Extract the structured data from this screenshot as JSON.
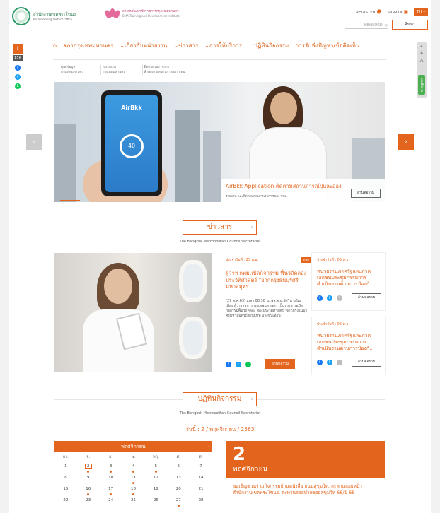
{
  "header": {
    "logo1_title": "สำนักงานเขตพระโขนง",
    "logo1_sub": "Phrakhanong District Office",
    "logo2_title": "สถาบันพัฒนาข้าราชการกรุงเทพมหานคร",
    "logo2_sub": "BMA Training and Development Institute",
    "register": "REGISTER",
    "signin": "SIGN IN",
    "lang": "TH",
    "keyword_placeholder": "KEYWORD",
    "search_btn": "ค้นหา"
  },
  "social": {
    "share_count": "15K"
  },
  "right_tools": {
    "a1": "A",
    "a2": "A",
    "a3": "A",
    "label": "กลุ่มนี้มีตาม"
  },
  "nav": {
    "items": [
      "สภากรุงเทพมหานคร",
      "เกี่ยวกับหน่วยงาน",
      "ข่าวสาร",
      "การให้บริการ",
      "ปฏิทินกิจกรรม",
      "การรับฟังปัญหา/ข้อคิดเห็น"
    ],
    "sub": [
      {
        "l1": "ศูนย์ข้อมูล",
        "l2": "กรุงเทพมหานคร"
      },
      {
        "l1": "หน่วยงาน",
        "l2": "กรุงเทพมหานคร"
      },
      {
        "l1": "ติดต่อส่วนราชการ",
        "l2": "สำนักงานเลขานุการสภา กทม."
      }
    ]
  },
  "hero": {
    "app_name": "AirBkk",
    "ring_value": "40",
    "caption_title": "AirBkk Application ติดตามสถานการณ์ฝุ่นละออง",
    "caption_sub": "รายงาน และติดตามคุณภาพอากาศของ กทม.",
    "button": "อ่านต่อรวม"
  },
  "news": {
    "header": "ข่าวสาร",
    "subtitle": "The Bangkok Metropolitan Council Secretariat",
    "featured": {
      "date": "ประจำวันที่ : 25 พ.ย.",
      "badge": "ล่าสุด",
      "title": "ผู้ว่าฯ กทม.เปิดกิจกรรม ฟื้นวิถีคลอง ประวัติศาสตร์ \"จากกรุงธนบุรีศรีมหาสมุทร..",
      "body": "(27 ต.ค.63) เวลา 08.30 น. พล.ต.อ.อัศวิน ขวัญเมือง ผู้ว่าราชการกรุงเทพมหานคร เป็นประธานเปิดกิจกรรมฟื้นวิถีคลอง ส่องประวัติศาสตร์ \"จากกรุงธนบุรีศรีมหาสมุทรถึงกรุงเทพ บางขุนเทียน\"",
      "button": "อ่านต่อรวม"
    },
    "cards": [
      {
        "date": "ประจำวันที่ : 05 พ.ย.",
        "title": "หน่วยงานภาครัฐและภาคเอกชนประชุมกรรมการดำเนินงานด้านการป้องกั..",
        "button": "อ่านต่อรวม"
      },
      {
        "date": "ประจำวันที่ : 05 พ.ย.",
        "title": "หน่วยงานภาครัฐและภาคเอกชนประชุมกรรมการดำเนินงานด้านการป้องกั..",
        "button": "อ่านต่อรวม"
      }
    ]
  },
  "activities": {
    "header": "ปฏิทินกิจกรรม",
    "subtitle": "The Bangkok Metropolitan Council Secretariat",
    "date_line": "วันนี้ : 2 / พฤศจิกายน / 2563",
    "calendar": {
      "month": "พฤศจิกายน",
      "days": [
        "อา.",
        "จ.",
        "อ.",
        "พ.",
        "พฤ.",
        "ศ.",
        "ส."
      ],
      "weeks": [
        [
          "1",
          "2",
          "3",
          "4",
          "5",
          "6",
          "7"
        ],
        [
          "8",
          "9",
          "10",
          "11",
          "12",
          "13",
          "14"
        ],
        [
          "15",
          "16",
          "17",
          "18",
          "19",
          "20",
          "21"
        ],
        [
          "22",
          "23",
          "24",
          "25",
          "26",
          "27",
          "28"
        ]
      ]
    },
    "big_day": "2",
    "big_month": "พฤศจิกายน",
    "event_text": "ขอเชิญชวนร่วมกิจกรรมบ้านหนังสือ ถนนสุขุมวิท, สะพานลอยหน้าสำนักงานเขตพระโขนง, สะพานลอยปากซอยสุขุมวิท 66/1-68"
  },
  "colors": {
    "accent": "#e3651d",
    "green": "#2e9a6a"
  }
}
